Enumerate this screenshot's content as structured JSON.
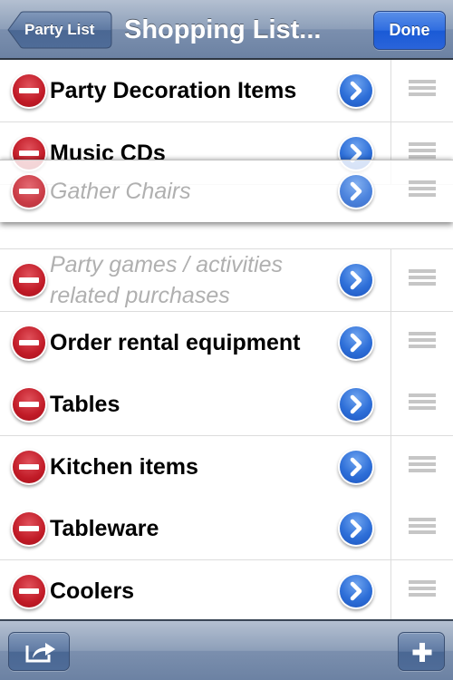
{
  "navbar": {
    "back_label": "Party List",
    "title": "Shopping List...",
    "done_label": "Done"
  },
  "list": {
    "items": [
      {
        "label": "Party Decoration Items",
        "style": "bold"
      },
      {
        "label": "Music CDs",
        "style": "bold"
      },
      {
        "label": "Party games / activities related purchases",
        "style": "placeholder"
      },
      {
        "label": "Order rental equipment",
        "style": "bold"
      },
      {
        "label": "Tables",
        "style": "bold"
      },
      {
        "label": "Kitchen items",
        "style": "bold"
      },
      {
        "label": "Tableware",
        "style": "bold"
      },
      {
        "label": "Coolers",
        "style": "bold"
      }
    ],
    "dragging_item": {
      "label": "Gather Chairs",
      "style": "placeholder"
    }
  },
  "toolbar": {
    "share_icon": "share-icon",
    "add_icon": "plus-icon"
  },
  "colors": {
    "navbar": "#7b8fae",
    "done_button": "#2a64da",
    "delete_control": "#c11b27",
    "disclosure_button": "#2e6fd8",
    "placeholder_text": "#b0b0b0"
  }
}
